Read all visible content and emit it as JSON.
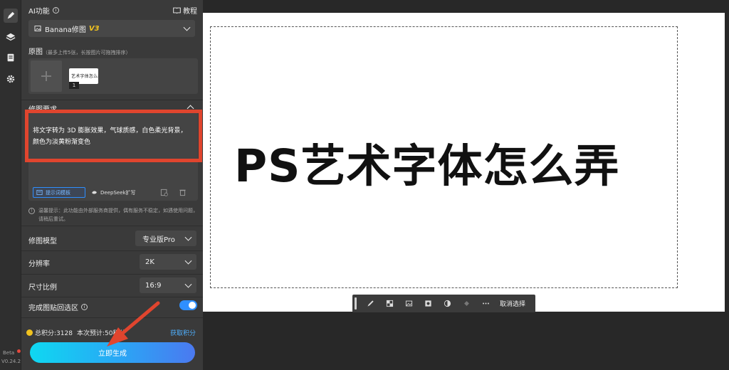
{
  "rail": {
    "beta_label": "Beta",
    "version": "V0.24.2"
  },
  "panel": {
    "ai_title": "AI功能",
    "tutorial_label": "教程",
    "model_select": {
      "name": "Banana修图",
      "badge": "V3"
    },
    "original": {
      "title": "原图",
      "hint": "（最多上传5张，长按图片可拖拽排序）",
      "thumb_text": "艺术字体怎么弄",
      "thumb_index": "1"
    },
    "requirements": {
      "title": "修图要求",
      "text": "将文字转为 3D 膨胀效果，气球质感，白色柔光背景，颜色为淡黄粉渐变色",
      "template_label": "提示词模板",
      "deepseek_label": "DeepSeek扩写"
    },
    "notice": "温馨提示：此功能由外部服务商提供，偶有服务不稳定，如遇使用问题，请稍后重试。",
    "retouch_model": {
      "label": "修图模型",
      "value": "专业版Pro"
    },
    "resolution": {
      "label": "分辨率",
      "value": "2K"
    },
    "aspect": {
      "label": "尺寸比例",
      "value": "16:9"
    },
    "paste_back": {
      "label": "完成图贴回选区",
      "enabled": true
    },
    "points": {
      "total": "总积分:3128",
      "estimate": "本次预计:",
      "estimate_value": "50积分"
    },
    "get_points": "获取积分",
    "generate": "立即生成"
  },
  "canvas": {
    "text": "PS艺术字体怎么弄"
  },
  "toolbar": {
    "cancel_selection": "取消选择"
  },
  "colors": {
    "accent_blue": "#2f8fff",
    "highlight_red": "#e0452e",
    "badge_yellow": "#f0c21f"
  }
}
